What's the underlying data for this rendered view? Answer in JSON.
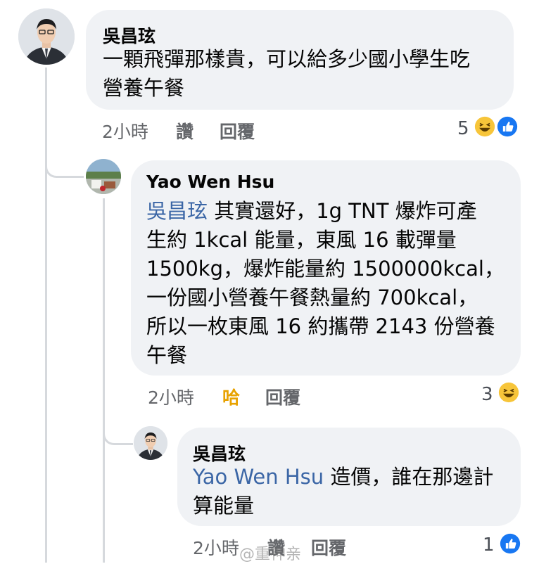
{
  "comments": [
    {
      "author": "吳昌玹",
      "lines": [
        "一顆飛彈那樣貴，可以給多少國小學生吃",
        "營養午餐"
      ],
      "time": "2小時",
      "action_like": "讚",
      "action_reply": "回覆",
      "reaction_count": "5",
      "reactions": [
        "haha-icon",
        "like-icon"
      ]
    },
    {
      "author": "Yao Wen Hsu",
      "mention": "吳昌玹",
      "lines": [
        " 其實還好，1g TNT 爆炸可產",
        "生約 1kcal 能量，東風 16 載彈量",
        "1500kg，爆炸能量約 1500000kcal，",
        "一份國小營養午餐熱量約 700kcal，",
        "所以一枚東風 16 約攜帶 2143 份營養",
        "午餐"
      ],
      "time": "2小時",
      "action_like": "哈",
      "action_reply": "回覆",
      "reaction_count": "3",
      "reactions": [
        "haha-icon"
      ]
    },
    {
      "author": "吳昌玹",
      "mention": "Yao Wen Hsu",
      "lines": [
        " 造價，誰在那邊計",
        "算能量"
      ],
      "time": "2小時",
      "action_like": "讚",
      "action_reply": "回覆",
      "reaction_count": "1",
      "reactions": [
        "like-icon"
      ]
    }
  ],
  "watermark": "@重神亲",
  "colors": {
    "bubble": "#f0f2f5",
    "mention": "#3b66a6",
    "meta": "#65676b",
    "like_blue": "#1877f2",
    "haha_yellow": "#f7c53a"
  }
}
